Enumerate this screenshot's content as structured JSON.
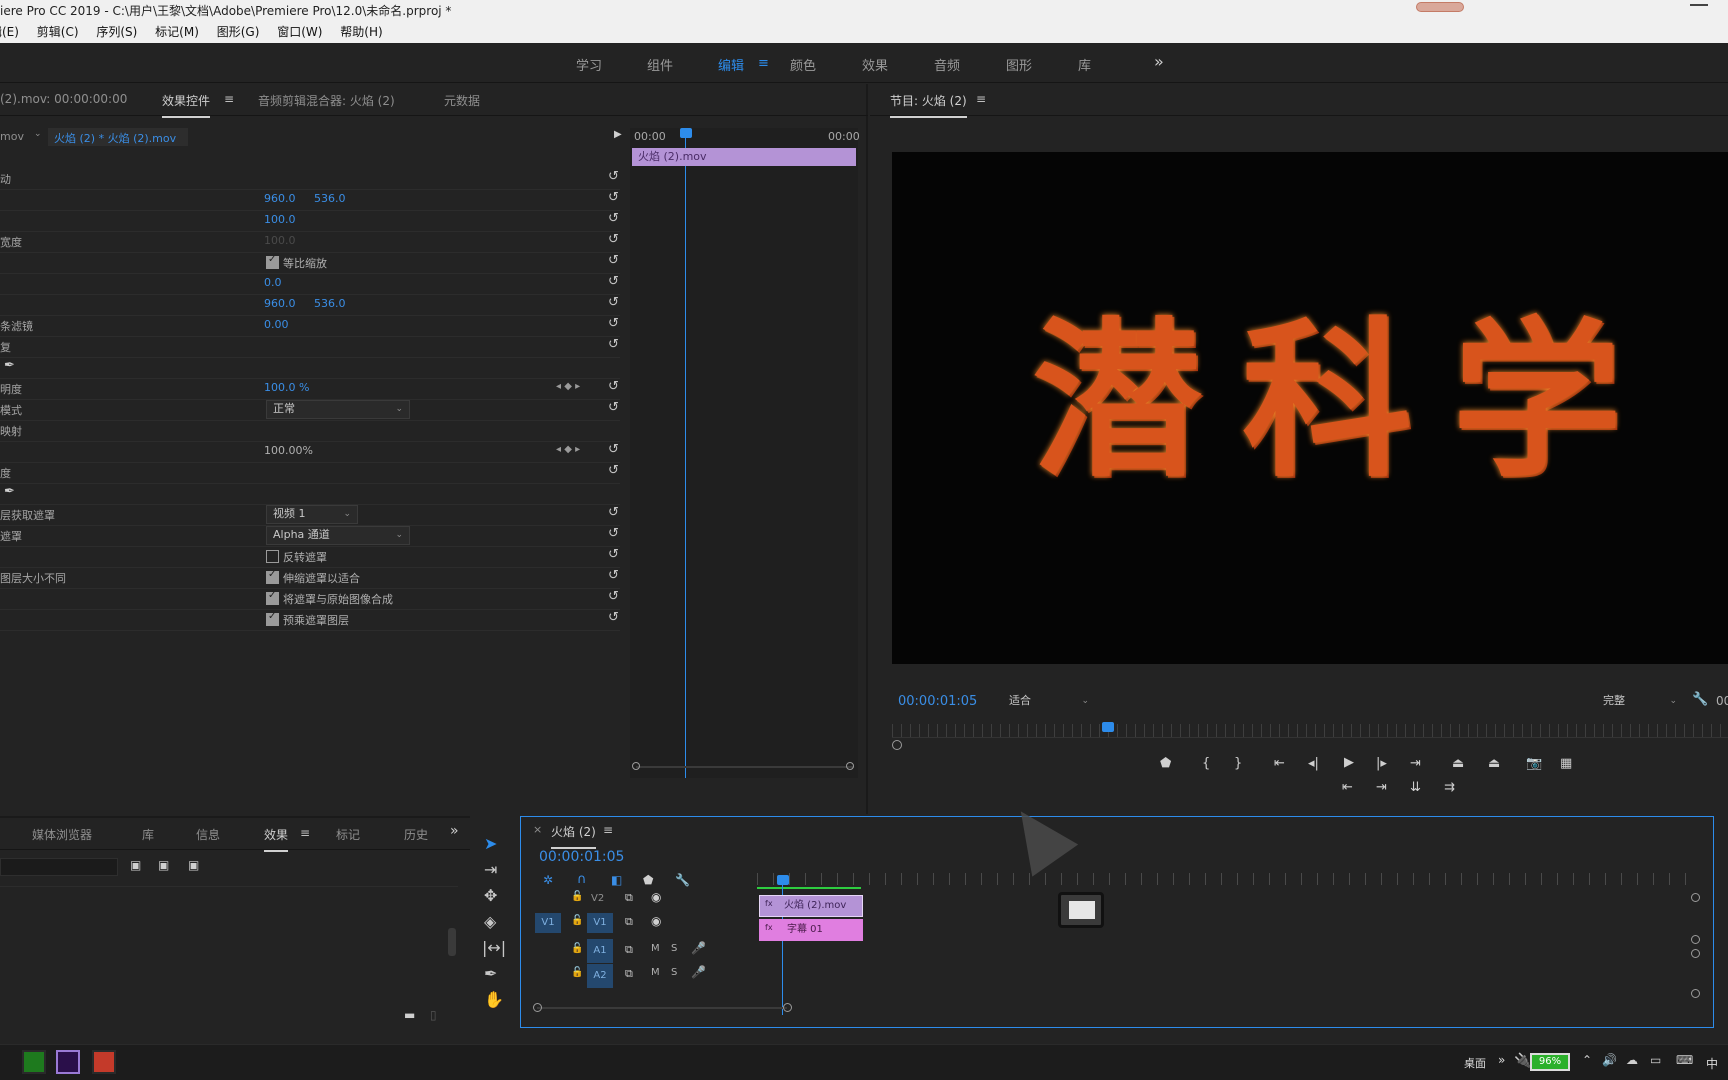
{
  "window": {
    "title": "iere Pro CC 2019 - C:\\用户\\王黎\\文档\\Adobe\\Premiere Pro\\12.0\\未命名.prproj *",
    "menu": [
      "编辑(E)",
      "剪辑(C)",
      "序列(S)",
      "标记(M)",
      "图形(G)",
      "窗口(W)",
      "帮助(H)"
    ]
  },
  "workspaces": {
    "items": [
      "学习",
      "组件",
      "编辑",
      "颜色",
      "效果",
      "音频",
      "图形",
      "库"
    ],
    "active": "编辑",
    "more": "»"
  },
  "effect_controls": {
    "tabs": [
      "(2).mov: 00:00:00:00",
      "效果控件",
      "音频剪辑混合器: 火焰 (2)",
      "元数据"
    ],
    "active_tab": "效果控件",
    "clip_selector": "mov",
    "clip_path": "火焰 (2) * 火焰 (2).mov",
    "timeline_start": "00:00",
    "timeline_end": "00:00",
    "clip_bar": "火焰 (2).mov",
    "rows": [
      {
        "label": "动"
      },
      {
        "label": "",
        "v1": "960.0",
        "v2": "536.0"
      },
      {
        "label": "",
        "v1": "100.0"
      },
      {
        "label": "宽度",
        "v1": "100.0",
        "dim": true
      },
      {
        "label": "",
        "checkbox": true,
        "checked": true,
        "text": "等比缩放"
      },
      {
        "label": "",
        "v1": "0.0"
      },
      {
        "label": "",
        "v1": "960.0",
        "v2": "536.0"
      },
      {
        "label": "条滤镜",
        "v1": "0.00"
      },
      {
        "label": "复"
      },
      {
        "label": "",
        "pen": true
      },
      {
        "label": "明度",
        "v1": "100.0 %",
        "kf": true
      },
      {
        "label": "模式",
        "select": "正常"
      },
      {
        "label": "映射"
      },
      {
        "label": "",
        "v0": "100.00%",
        "kf": true
      },
      {
        "label": "度"
      },
      {
        "label": "",
        "pen": true
      },
      {
        "label": "层获取遮罩",
        "select_small": "视频 1"
      },
      {
        "label": "遮罩",
        "select": "Alpha 通道"
      },
      {
        "label": "",
        "checkbox": true,
        "checked": false,
        "text": "反转遮罩"
      },
      {
        "label": "图层大小不同",
        "checkbox": true,
        "checked": true,
        "text": "伸缩遮罩以适合"
      },
      {
        "label": "",
        "checkbox": true,
        "checked": true,
        "text": "将遮罩与原始图像合成"
      },
      {
        "label": "",
        "checkbox": true,
        "checked": true,
        "text": "预乘遮罩图层"
      }
    ]
  },
  "program_monitor": {
    "title": "节目: 火焰 (2)",
    "frame_text": "潜科学",
    "timecode": "00:00:01:05",
    "fit": "适合",
    "quality": "完整",
    "right_timecode": "00"
  },
  "project_panel": {
    "tabs": [
      "媒体浏览器",
      "库",
      "信息",
      "效果",
      "标记",
      "历史"
    ],
    "active_tab": "效果",
    "more": "»"
  },
  "timeline": {
    "title": "火焰 (2)",
    "timecode": "00:00:01:05",
    "tracks": [
      {
        "target": "",
        "name": "V2",
        "clip": "火焰 (2).mov",
        "clip_icon": "fx"
      },
      {
        "target": "V1",
        "name": "V1",
        "clip": "字幕 01",
        "clip_icon": "fx"
      },
      {
        "target": "",
        "name": "A1",
        "m": "M",
        "s": "S"
      },
      {
        "target": "",
        "name": "A2",
        "m": "M",
        "s": "S"
      }
    ]
  },
  "taskbar": {
    "desktop_label": "桌面",
    "chevron": "»",
    "battery": "96%",
    "ime": "中"
  },
  "colors": {
    "accent": "#2d8ceb",
    "clip_video": "#b493d6",
    "clip_title": "#e07ee0",
    "panel_bg": "#232323",
    "fire_text": "#d8541c"
  }
}
